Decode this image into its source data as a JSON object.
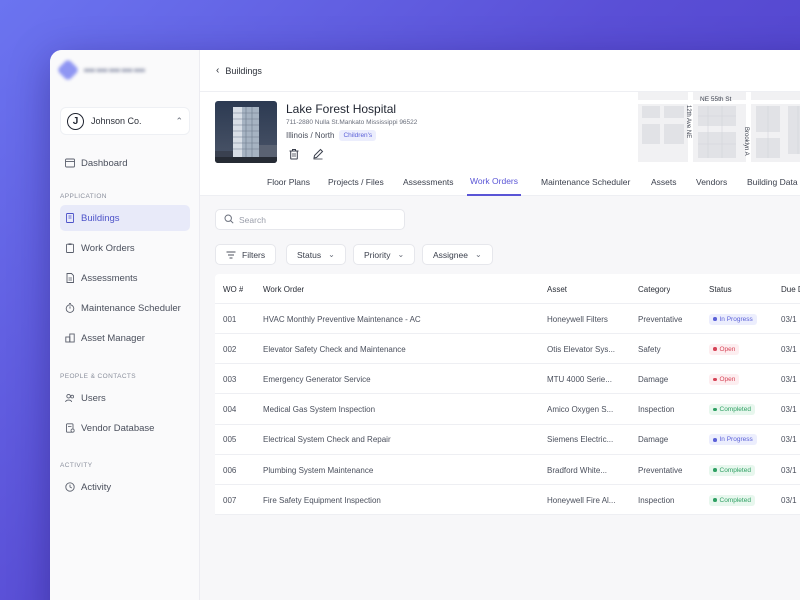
{
  "sidebar": {
    "org_name": "Johnson Co.",
    "org_initial": "J",
    "sections": {
      "application": "APPLICATION",
      "people": "PEOPLE & CONTACTS",
      "activity": "ACTIVITY"
    },
    "items": [
      {
        "label": "Dashboard",
        "icon": "dashboard-icon"
      },
      {
        "label": "Buildings",
        "icon": "building-icon",
        "active": true
      },
      {
        "label": "Work Orders",
        "icon": "clipboard-icon"
      },
      {
        "label": "Assessments",
        "icon": "document-icon"
      },
      {
        "label": "Maintenance Scheduler",
        "icon": "clock-icon"
      },
      {
        "label": "Asset Manager",
        "icon": "boxes-icon"
      },
      {
        "label": "Users",
        "icon": "users-icon"
      },
      {
        "label": "Vendor Database",
        "icon": "database-icon"
      },
      {
        "label": "Activity",
        "icon": "clock-icon"
      }
    ]
  },
  "breadcrumb": {
    "label": "Buildings"
  },
  "building": {
    "name": "Lake Forest Hospital",
    "address": "711-2880 Nulla St.Mankato Mississippi 96522",
    "location": "Illinois / North",
    "tag": "Children's"
  },
  "map": {
    "labels": [
      "NE 55th St",
      "12th Ave NE",
      "Brooklyn A"
    ]
  },
  "tabs": [
    "Floor Plans",
    "Projects / Files",
    "Assessments",
    "Work Orders",
    "Maintenance Scheduler",
    "Assets",
    "Vendors",
    "Building Data"
  ],
  "active_tab": "Work Orders",
  "search": {
    "placeholder": "Search"
  },
  "filters": {
    "filters_label": "Filters",
    "status_label": "Status",
    "priority_label": "Priority",
    "assignee_label": "Assignee"
  },
  "table": {
    "columns": [
      "WO #",
      "Work Order",
      "Asset",
      "Category",
      "Status",
      "Due D"
    ],
    "rows": [
      {
        "wo": "001",
        "work_order": "HVAC Monthly Preventive Maintenance - AC",
        "asset": "Honeywell Filters",
        "category": "Preventative",
        "status": "In Progress",
        "due": "03/1"
      },
      {
        "wo": "002",
        "work_order": "Elevator Safety Check and Maintenance",
        "asset": "Otis Elevator Sys...",
        "category": "Safety",
        "status": "Open",
        "due": "03/1"
      },
      {
        "wo": "003",
        "work_order": "Emergency Generator Service",
        "asset": "MTU 4000 Serie...",
        "category": "Damage",
        "status": "Open",
        "due": "03/1"
      },
      {
        "wo": "004",
        "work_order": "Medical Gas System Inspection",
        "asset": "Amico Oxygen S...",
        "category": "Inspection",
        "status": "Completed",
        "due": "03/1"
      },
      {
        "wo": "005",
        "work_order": "Electrical System Check and Repair",
        "asset": "Siemens Electric...",
        "category": "Damage",
        "status": "In Progress",
        "due": "03/1"
      },
      {
        "wo": "006",
        "work_order": "Plumbing System Maintenance",
        "asset": "Bradford White...",
        "category": "Preventative",
        "status": "Completed",
        "due": "03/1"
      },
      {
        "wo": "007",
        "work_order": "Fire Safety Equipment Inspection",
        "asset": "Honeywell Fire Al...",
        "category": "Inspection",
        "status": "Completed",
        "due": "03/1"
      }
    ]
  },
  "status_colors": {
    "In Progress": {
      "bg": "#eceefd",
      "fg": "#5b61d8",
      "dot": "#5b61d8"
    },
    "Open": {
      "bg": "#fdeef0",
      "fg": "#d64356",
      "dot": "#d64356"
    },
    "Completed": {
      "bg": "#e8f7ee",
      "fg": "#2fa063",
      "dot": "#2fa063"
    }
  },
  "colors": {
    "accent": "#5a55d6"
  }
}
